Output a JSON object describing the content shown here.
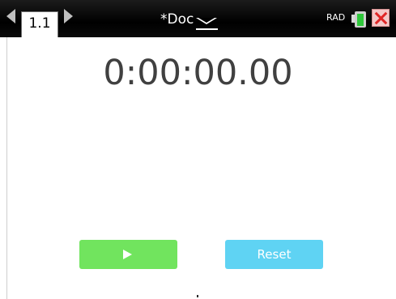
{
  "header": {
    "tab_label": "1.1",
    "doc_title": "*Doc",
    "angle_mode": "RAD"
  },
  "stopwatch": {
    "time": "0:00:00.00"
  },
  "controls": {
    "reset_label": "Reset"
  },
  "colors": {
    "title_bar": "#000000",
    "play_button": "#71e45e",
    "reset_button": "#5fd3f3",
    "timer_text": "#404040",
    "close_button": "#e02626",
    "battery_level": "#2ec73a"
  },
  "icons": {
    "prev_page": "triangle-left-icon",
    "next_page": "triangle-right-icon",
    "doc_menu": "chevron-down-icon",
    "battery": "battery-icon",
    "close": "close-icon",
    "play": "play-icon"
  }
}
